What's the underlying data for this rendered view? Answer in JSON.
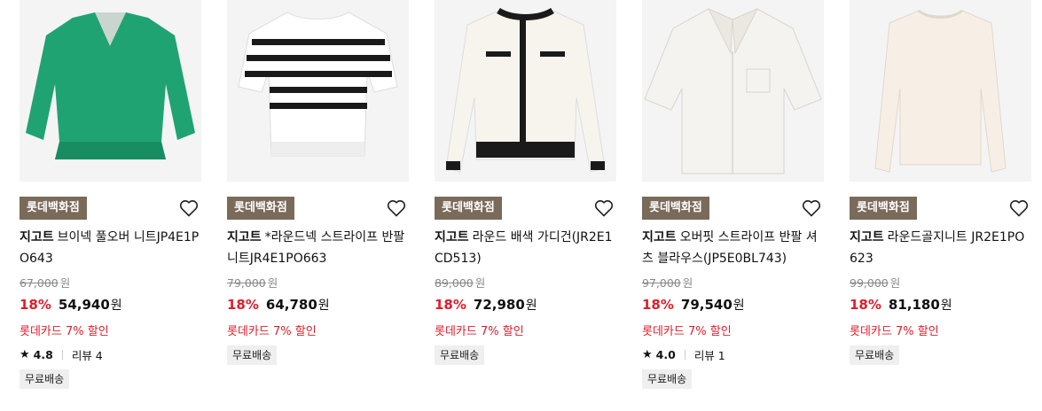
{
  "products": [
    {
      "store": "롯데백화점",
      "brand": "지고트",
      "name": "브이넥 풀오버 니트JP4E1PO643",
      "original_price": "67,000",
      "discount": "18%",
      "price": "54,940",
      "currency": "원",
      "card_promo": "롯데카드 7% 할인",
      "rating": "4.8",
      "reviews": "리뷰 4",
      "shipping": "무료배송",
      "image_color": "#1fa373"
    },
    {
      "store": "롯데백화점",
      "brand": "지고트",
      "name": "*라운드넥 스트라이프 반팔 니트JR4E1PO663",
      "original_price": "79,000",
      "discount": "18%",
      "price": "64,780",
      "currency": "원",
      "card_promo": "롯데카드 7% 할인",
      "rating": null,
      "reviews": null,
      "shipping": "무료배송",
      "image_color": "#ffffff"
    },
    {
      "store": "롯데백화점",
      "brand": "지고트",
      "name": "라운드 배색 가디건(JR2E1CD513)",
      "original_price": "89,000",
      "discount": "18%",
      "price": "72,980",
      "currency": "원",
      "card_promo": "롯데카드 7% 할인",
      "rating": null,
      "reviews": null,
      "shipping": "무료배송",
      "image_color": "#f7f4ee"
    },
    {
      "store": "롯데백화점",
      "brand": "지고트",
      "name": "오버핏 스트라이프 반팔 셔츠 블라우스(JP5E0BL743)",
      "original_price": "97,000",
      "discount": "18%",
      "price": "79,540",
      "currency": "원",
      "card_promo": "롯데카드 7% 할인",
      "rating": "4.0",
      "reviews": "리뷰 1",
      "shipping": "무료배송",
      "image_color": "#f5f3ef"
    },
    {
      "store": "롯데백화점",
      "brand": "지고트",
      "name": "라운드골지니트 JR2E1PO623",
      "original_price": "99,000",
      "discount": "18%",
      "price": "81,180",
      "currency": "원",
      "card_promo": "롯데카드 7% 할인",
      "rating": null,
      "reviews": null,
      "shipping": "무료배송",
      "image_color": "#f7efe6"
    }
  ],
  "colors": {
    "badge_bg": "#7a6a5a",
    "discount_red": "#e11c2a",
    "thumb_bg": "#f4f4f4"
  },
  "icons": {
    "heart": "heart-outline-icon",
    "star": "star-icon"
  }
}
